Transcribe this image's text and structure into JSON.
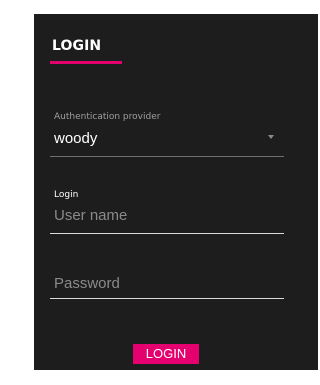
{
  "login_form": {
    "title": "LOGIN",
    "provider_label": "Authentication provider",
    "provider_value": "woody",
    "login_label": "Login",
    "username_placeholder": "User name",
    "password_placeholder": "Password",
    "submit_label": "LOGIN"
  },
  "colors": {
    "accent": "#e4006f",
    "panel_background": "#1e1d1d"
  },
  "icons": {
    "provider_dropdown": "caret-down-icon"
  }
}
